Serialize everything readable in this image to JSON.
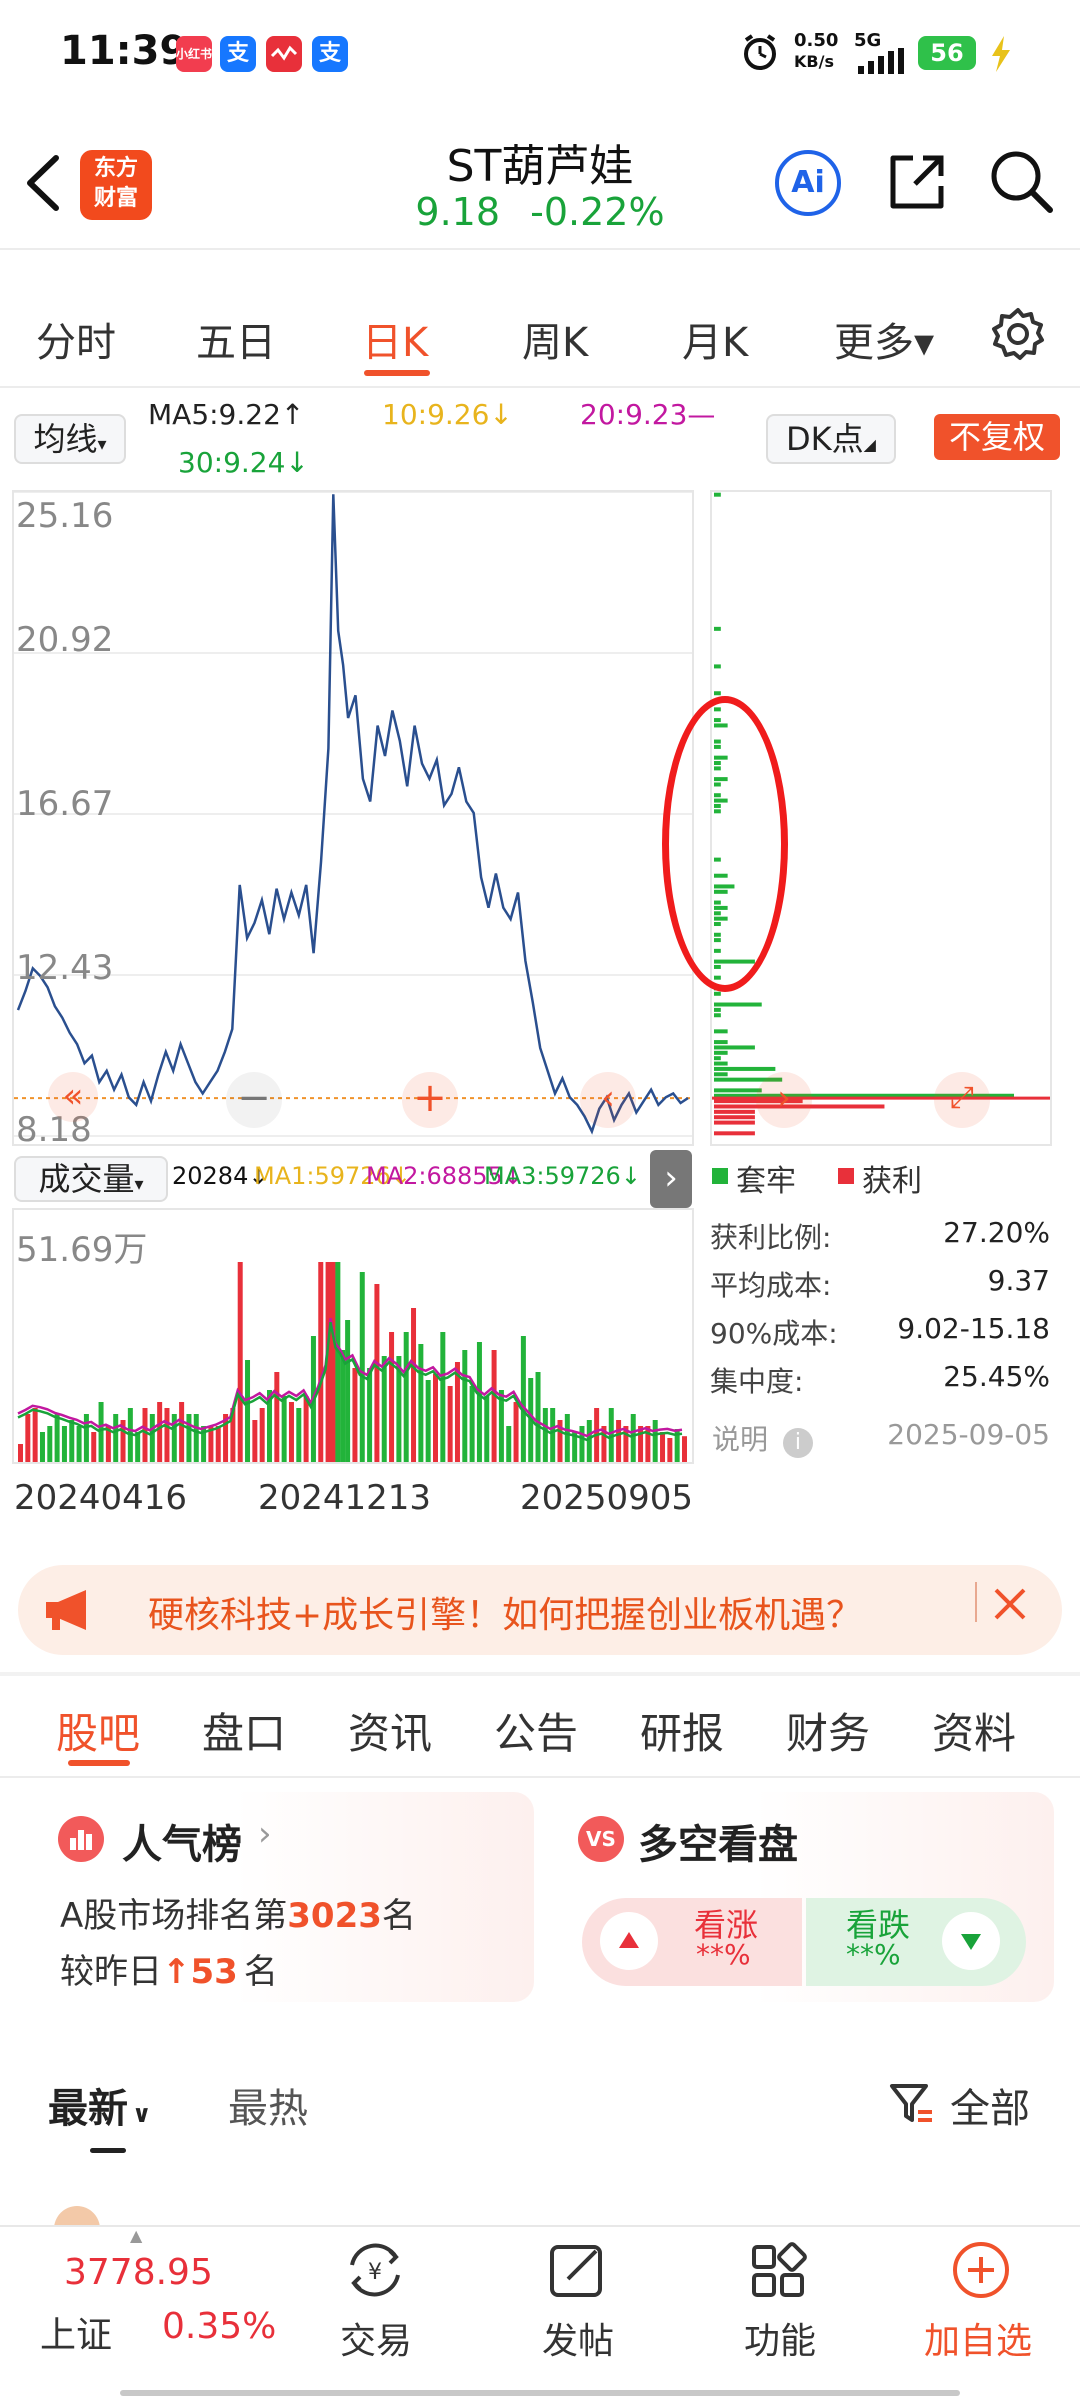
{
  "status_bar": {
    "time": "11:39",
    "app_icons": [
      "小红书",
      "支",
      "",
      "支"
    ],
    "net_speed_value": "0.50",
    "net_speed_unit": "KB/s",
    "network": "5G",
    "battery": "56"
  },
  "header": {
    "logo_line1": "东方",
    "logo_line2": "财富",
    "stock_name": "ST葫芦娃",
    "price": "9.18",
    "change_pct": "-0.22%",
    "ai_label": "Ai"
  },
  "period_tabs": [
    {
      "label": "分时"
    },
    {
      "label": "五日"
    },
    {
      "label": "日K"
    },
    {
      "label": "周K"
    },
    {
      "label": "月K"
    },
    {
      "label": "更多▾"
    }
  ],
  "indicator_row": {
    "ma_select": "均线",
    "ma5": "MA5:9.22↑",
    "ma10": "10:9.26↓",
    "ma20": "20:9.23—",
    "ma30": "30:9.24↓",
    "dk_select": "DK点",
    "fq_button": "不复权"
  },
  "chart_data": {
    "type": "line",
    "series": [
      {
        "values": [
          [
            0,
            11.5
          ],
          [
            3,
            12.0
          ],
          [
            6,
            12.6
          ],
          [
            9,
            12.4
          ],
          [
            12,
            12.1
          ],
          [
            15,
            11.6
          ],
          [
            18,
            11.3
          ],
          [
            21,
            10.9
          ],
          [
            24,
            10.6
          ],
          [
            27,
            10.1
          ],
          [
            30,
            10.3
          ],
          [
            33,
            9.6
          ],
          [
            36,
            9.9
          ],
          [
            39,
            9.4
          ],
          [
            42,
            9.8
          ],
          [
            45,
            9.2
          ],
          [
            48,
            9.0
          ],
          [
            51,
            9.6
          ],
          [
            54,
            9.1
          ],
          [
            57,
            9.8
          ],
          [
            60,
            10.4
          ],
          [
            63,
            9.9
          ],
          [
            66,
            10.6
          ],
          [
            69,
            10.1
          ],
          [
            72,
            9.6
          ],
          [
            75,
            9.3
          ],
          [
            78,
            9.6
          ],
          [
            81,
            9.9
          ],
          [
            84,
            10.4
          ],
          [
            87,
            11.0
          ],
          [
            90,
            14.8
          ],
          [
            93,
            13.4
          ],
          [
            96,
            13.8
          ],
          [
            99,
            14.4
          ],
          [
            102,
            13.5
          ],
          [
            105,
            14.7
          ],
          [
            108,
            13.9
          ],
          [
            111,
            14.6
          ],
          [
            114,
            14.0
          ],
          [
            117,
            14.8
          ],
          [
            120,
            13.0
          ],
          [
            123,
            15.4
          ],
          [
            126,
            18.4
          ],
          [
            128,
            25.1
          ],
          [
            130,
            21.5
          ],
          [
            132,
            20.6
          ],
          [
            134,
            19.2
          ],
          [
            137,
            19.8
          ],
          [
            140,
            17.6
          ],
          [
            143,
            17.0
          ],
          [
            146,
            19.0
          ],
          [
            149,
            18.2
          ],
          [
            152,
            19.4
          ],
          [
            155,
            18.6
          ],
          [
            158,
            17.4
          ],
          [
            161,
            19.0
          ],
          [
            164,
            18.0
          ],
          [
            167,
            17.6
          ],
          [
            170,
            18.1
          ],
          [
            173,
            16.9
          ],
          [
            176,
            17.2
          ],
          [
            179,
            17.9
          ],
          [
            182,
            17.0
          ],
          [
            185,
            16.7
          ],
          [
            188,
            15.0
          ],
          [
            191,
            14.2
          ],
          [
            194,
            15.1
          ],
          [
            197,
            14.2
          ],
          [
            200,
            13.9
          ],
          [
            203,
            14.6
          ],
          [
            206,
            12.8
          ],
          [
            209,
            11.7
          ],
          [
            212,
            10.5
          ],
          [
            215,
            9.9
          ],
          [
            218,
            9.3
          ],
          [
            221,
            9.7
          ],
          [
            224,
            9.2
          ],
          [
            227,
            9.0
          ],
          [
            230,
            8.7
          ],
          [
            233,
            8.3
          ],
          [
            236,
            8.9
          ],
          [
            239,
            9.2
          ],
          [
            242,
            8.6
          ],
          [
            245,
            9.0
          ],
          [
            248,
            9.3
          ],
          [
            251,
            8.8
          ],
          [
            254,
            9.1
          ],
          [
            257,
            9.4
          ],
          [
            260,
            9.0
          ],
          [
            263,
            9.2
          ],
          [
            266,
            9.3
          ],
          [
            269,
            9.05
          ],
          [
            272,
            9.18
          ]
        ]
      }
    ],
    "y_ticks": [
      "25.16",
      "20.92",
      "16.67",
      "12.43",
      "8.18"
    ],
    "ylim": [
      8.18,
      25.16
    ],
    "x_ticks": [
      "20240416",
      "20241213",
      "20250905"
    ],
    "reference_price": 9.18,
    "volume": {
      "label": "成交量",
      "current": "20284↓",
      "ma1": "MA1:59726↓",
      "ma2": "MA2:68855↓",
      "ma3": "MA3:59726↓",
      "max_label": "51.69万"
    }
  },
  "chip_panel": {
    "legend_trapped": "套牢",
    "legend_profit": "获利",
    "stats": [
      {
        "k": "获利比例:",
        "v": "27.20%"
      },
      {
        "k": "平均成本:",
        "v": "9.37"
      },
      {
        "k": "90%成本:",
        "v": "9.02-15.18"
      },
      {
        "k": "集中度:",
        "v": "25.45%"
      }
    ],
    "note_label": "说明",
    "date": "2025-09-05"
  },
  "banner": {
    "text": "硬核科技+成长引擎！如何把握创业板机遇？"
  },
  "sub_tabs": [
    "股吧",
    "盘口",
    "资讯",
    "公告",
    "研报",
    "财务",
    "资料"
  ],
  "popularity": {
    "title": "人气榜",
    "line1_prefix": "A股市场排名第",
    "rank": "3023",
    "line1_suffix": "名",
    "line2_prefix": "较昨日",
    "change": "53",
    "line2_suffix": "名"
  },
  "sentiment": {
    "title": "多空看盘",
    "up_label": "看涨",
    "up_value": "**%",
    "down_label": "看跌",
    "down_value": "**%"
  },
  "feed": {
    "sort_latest": "最新",
    "sort_hot": "最热",
    "filter_all": "全部"
  },
  "bottom_nav": {
    "index_value": "3778.95",
    "index_name": "上证",
    "index_change": "0.35%",
    "trade": "交易",
    "post": "发帖",
    "functions": "功能",
    "add_watch": "加自选"
  },
  "colors": {
    "accent": "#f0522b",
    "up_red": "#e8303a",
    "down_green": "#19a33a",
    "line_blue": "#2a4f8f"
  }
}
